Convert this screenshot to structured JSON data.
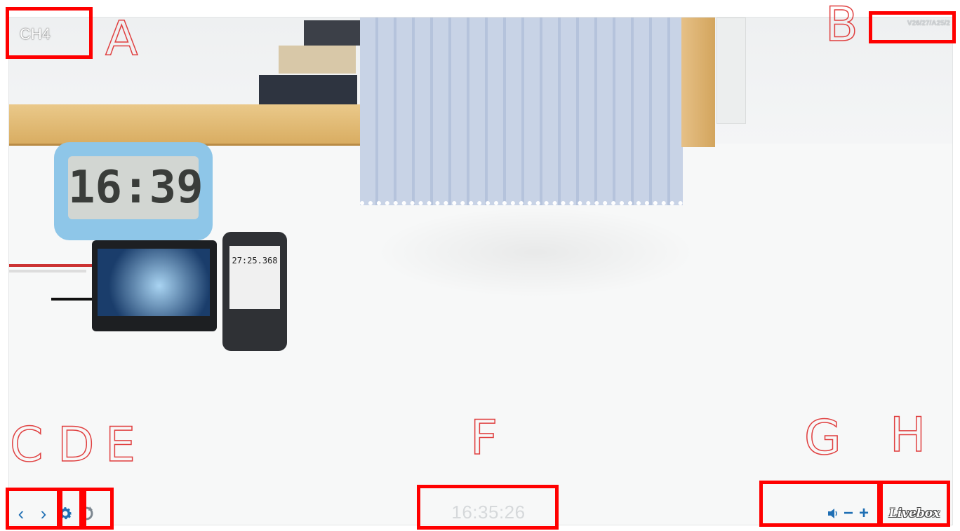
{
  "viewer": {
    "channel": "CH4",
    "version": "V26/27/A25/2",
    "timestamp": "16:35:26",
    "brand": "Livebox",
    "prev_glyph": "‹",
    "next_glyph": "›",
    "volume_down_glyph": "−",
    "volume_up_glyph": "+",
    "accent_color": "#1f6fb4"
  },
  "scene": {
    "clock_display": "16:39",
    "pda_display": "27:25.368"
  },
  "annotations": {
    "A": "A",
    "B": "B",
    "C": "C",
    "D": "D",
    "E": "E",
    "F": "F",
    "G": "G",
    "H": "H",
    "box_color": "#ff0000"
  },
  "icons": {
    "settings": "gear-icon",
    "refresh": "refresh-icon",
    "volume": "speaker-icon"
  }
}
